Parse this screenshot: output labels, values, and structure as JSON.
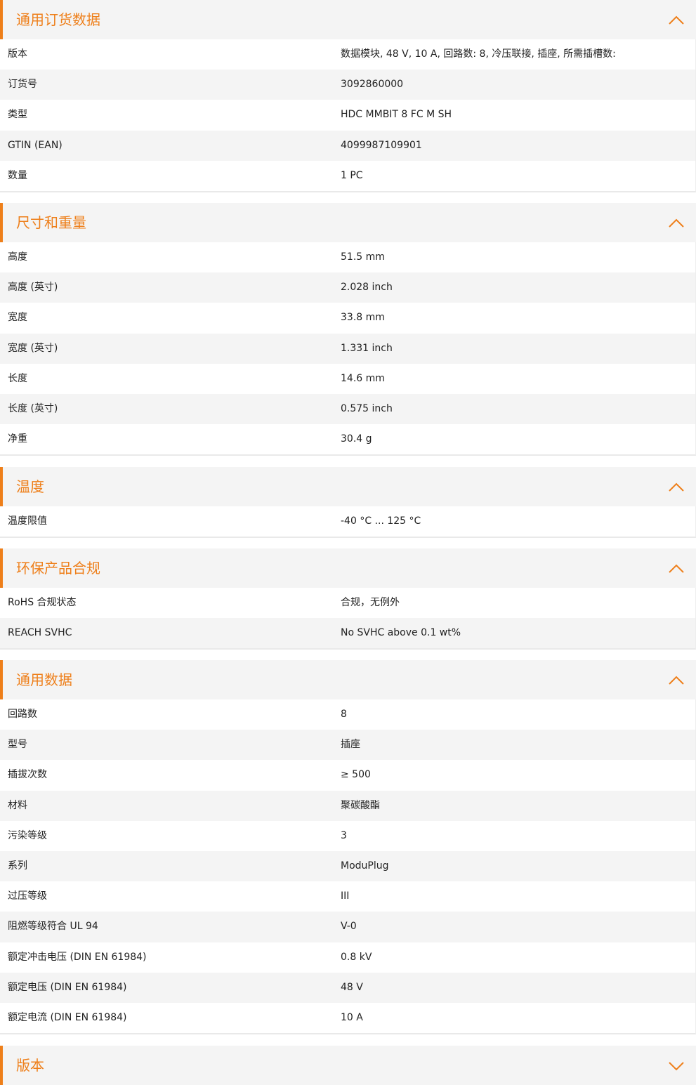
{
  "sections": [
    {
      "title": "通用订货数据",
      "rows": [
        {
          "label": "版本",
          "value": "数据模块, 48 V, 10 A, 回路数: 8, 冷压联接, 插座, 所需插槽数:"
        },
        {
          "label": "订货号",
          "value": "3092860000"
        },
        {
          "label": "类型",
          "value": "HDC MMBIT 8 FC M SH"
        },
        {
          "label": "GTIN (EAN)",
          "value": "4099987109901"
        },
        {
          "label": "数量",
          "value": "1  PC"
        }
      ]
    },
    {
      "title": "尺寸和重量",
      "rows": [
        {
          "label": "高度",
          "value": "51.5  mm"
        },
        {
          "label": "高度 (英寸)",
          "value": "2.028  inch"
        },
        {
          "label": "宽度",
          "value": "33.8  mm"
        },
        {
          "label": "宽度 (英寸)",
          "value": "1.331  inch"
        },
        {
          "label": "长度",
          "value": "14.6  mm"
        },
        {
          "label": "长度 (英寸)",
          "value": "0.575  inch"
        },
        {
          "label": "净重",
          "value": "30.4  g"
        }
      ]
    },
    {
      "title": "温度",
      "rows": [
        {
          "label": "温度限值",
          "value": "-40 °C ... 125 °C"
        }
      ]
    },
    {
      "title": "环保产品合规",
      "rows": [
        {
          "label": "RoHS 合规状态",
          "value": "合规，无例外"
        },
        {
          "label": "REACH SVHC",
          "value": "No SVHC above 0.1 wt%"
        }
      ]
    },
    {
      "title": "通用数据",
      "rows": [
        {
          "label": "回路数",
          "value": "8"
        },
        {
          "label": "型号",
          "value": "插座"
        },
        {
          "label": "插拔次数",
          "value": "≥ 500"
        },
        {
          "label": "材料",
          "value": "聚碳酸酯"
        },
        {
          "label": "污染等级",
          "value": "3"
        },
        {
          "label": "系列",
          "value": "ModuPlug"
        },
        {
          "label": "过压等级",
          "value": "III"
        },
        {
          "label": "阻燃等级符合 UL 94",
          "value": "V-0"
        },
        {
          "label": "额定冲击电压 (DIN EN 61984)",
          "value": "0.8  kV"
        },
        {
          "label": "额定电压 (DIN EN 61984)",
          "value": "48  V"
        },
        {
          "label": "额定电流 (DIN EN 61984)",
          "value": "10  A"
        }
      ]
    },
    {
      "title": "版本",
      "rows": []
    }
  ],
  "icons": {
    "toggle": "chevron-up-icon"
  },
  "colors": {
    "accent": "#ee7f1a",
    "header_bg": "#f4f4f4",
    "row_alt_bg": "#f4f4f4"
  }
}
